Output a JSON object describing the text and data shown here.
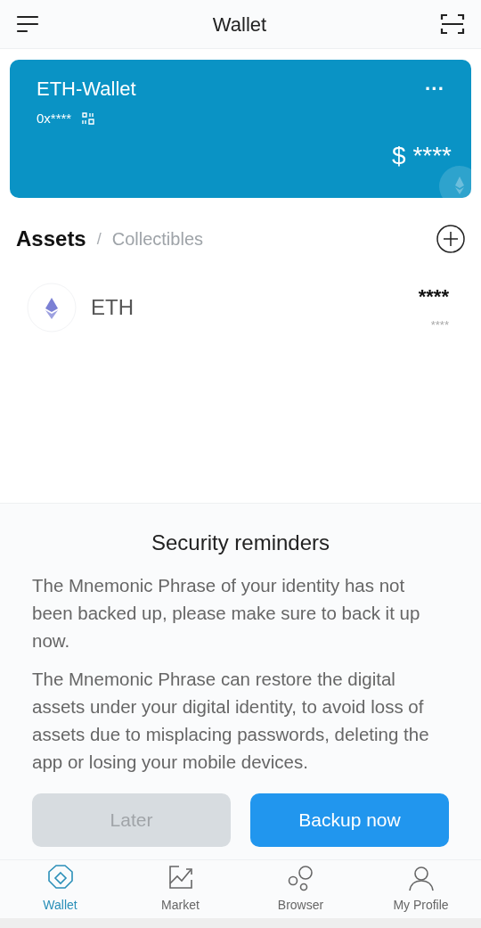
{
  "header": {
    "title": "Wallet"
  },
  "wallet_card": {
    "name": "ETH-Wallet",
    "address": "0x****",
    "menu": "···",
    "balance": "$ ****"
  },
  "tabs": [
    {
      "label": "Assets",
      "selected": true
    },
    {
      "label": "Collectibles",
      "selected": false
    }
  ],
  "tab_separator": "/",
  "assets": [
    {
      "symbol": "ETH",
      "amount": "****",
      "value": "****"
    }
  ],
  "reminder": {
    "title": "Security reminders",
    "paragraphs": [
      "The Mnemonic Phrase of your identity has not been backed up, please make sure to back it up now.",
      "The Mnemonic Phrase can restore the digital assets under your digital identity, to avoid loss of assets due to misplacing passwords, deleting the app or losing your mobile devices."
    ],
    "buttons": [
      {
        "label": "Later",
        "disabled": true
      },
      {
        "label": "Backup now",
        "disabled": false
      }
    ]
  },
  "nav": [
    {
      "kind": "wallet",
      "label": "Wallet",
      "selected": true
    },
    {
      "kind": "market",
      "label": "Market",
      "selected": false
    },
    {
      "kind": "browser",
      "label": "Browser",
      "selected": false
    },
    {
      "kind": "profile",
      "label": "My Profile",
      "selected": false
    }
  ]
}
